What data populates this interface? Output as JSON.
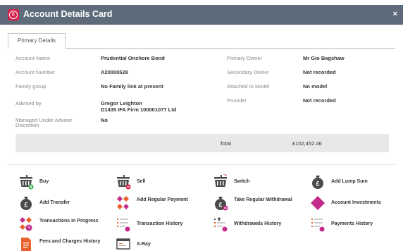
{
  "window": {
    "title": "Account Details Card",
    "close_glyph": "×",
    "brand_glyph": "£"
  },
  "tabs": [
    "Primary Details"
  ],
  "details": {
    "account_name_label": "Account Name",
    "account_name_value": "Prudential Onshore Bond",
    "account_number_label": "Account Number",
    "account_number_value": "A20000528",
    "family_group_label": "Family group",
    "family_group_value": "No Family link at present",
    "advised_by_label": "Advised by",
    "advised_by_value_1": "Gregor Leighton",
    "advised_by_value_2": "D1435 IFA Firm 100001077 Ltd",
    "managed_label_1": "Managed Under Adviser",
    "managed_label_2": "Discretion",
    "managed_value": "No",
    "primary_owner_label": "Primary Owner",
    "primary_owner_value": "Mr Gio Bagshaw",
    "secondary_owner_label": "Secondary Owner",
    "secondary_owner_value": "Not recorded",
    "attached_model_label": "Attached to Model",
    "attached_model_value": "No model",
    "provider_label": "Provider",
    "provider_value": "Not recorded"
  },
  "total": {
    "label": "Total",
    "value": "£102,452.46"
  },
  "actions": {
    "buy": {
      "label": "Buy",
      "icon": "basket-plus-icon"
    },
    "sell": {
      "label": "Sell",
      "icon": "basket-minus-icon"
    },
    "switch": {
      "label": "Switch",
      "icon": "basket-switch-icon"
    },
    "add_lump_sum": {
      "label": "Add Lump Sum",
      "icon": "money-bag-icon"
    },
    "add_transfer": {
      "label": "Add Transfer",
      "icon": "money-bag-icon"
    },
    "add_regular_payment": {
      "label": "Add Regular Payment",
      "icon": "diamonds-icon"
    },
    "take_regular_withdrawal": {
      "label": "Take Regular Withdrawal",
      "icon": "money-bag-minus-icon"
    },
    "account_investments": {
      "label": "Account Investments",
      "icon": "diamond-icon"
    },
    "transactions_in_progress": {
      "label": "Transactions in Progress",
      "icon": "diamonds-clock-icon"
    },
    "transaction_history": {
      "label": "Transaction History",
      "icon": "list-icon"
    },
    "withdrawals_history": {
      "label": "Withdrawals History",
      "icon": "list-icon"
    },
    "payments_history": {
      "label": "Payments History",
      "icon": "list-icon"
    },
    "fees_and_charges_history": {
      "label": "Fees and Charges History",
      "icon": "document-icon"
    },
    "xray": {
      "label": "X-Ray",
      "icon": "screen-icon"
    }
  },
  "colors": {
    "titlebar": "#5d6b7a",
    "brand": "#d6204a",
    "magenta": "#c42a8c",
    "orange": "#e8602a",
    "green": "#3aa64a",
    "red": "#d6204a",
    "dark_icon": "#4a4a4a"
  }
}
